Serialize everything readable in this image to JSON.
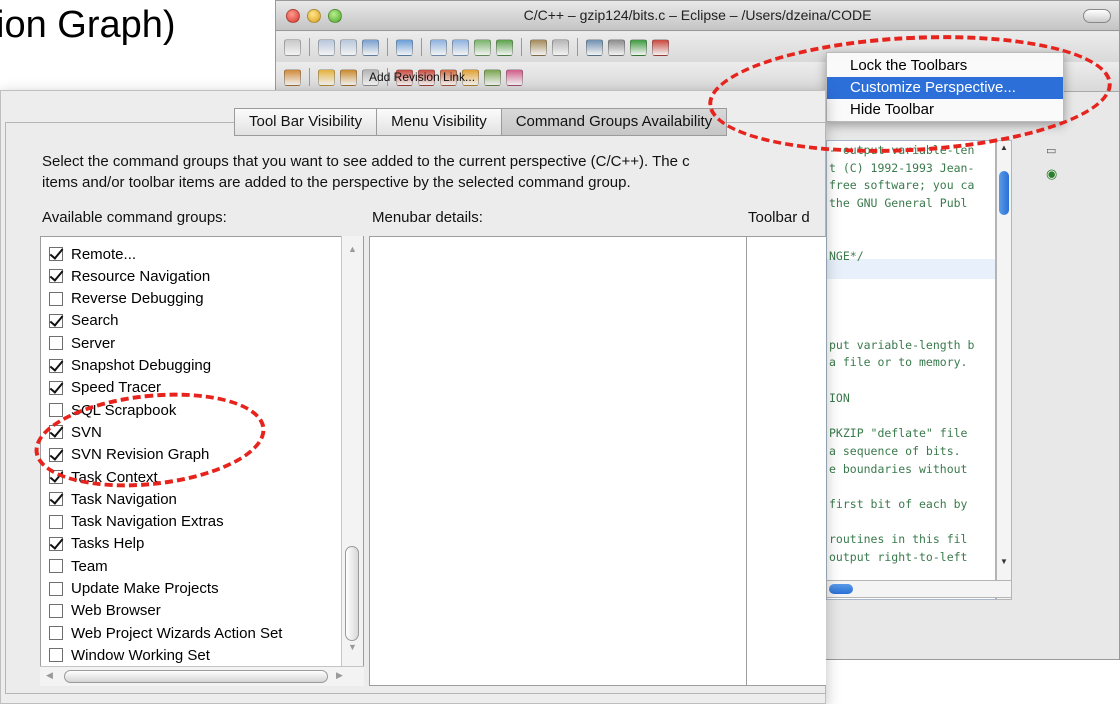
{
  "slide": {
    "title": "ion Graph)"
  },
  "window": {
    "title": "C/C++ – gzip124/bits.c – Eclipse – /Users/dzeina/CODE",
    "toolbar": {
      "add_revision_link": "Add Revision Link..."
    }
  },
  "context_menu": {
    "items": [
      {
        "label": "Lock the Toolbars",
        "selected": false
      },
      {
        "label": "Customize Perspective...",
        "selected": true
      },
      {
        "label": "Hide Toolbar",
        "selected": false
      }
    ]
  },
  "dialog": {
    "tabs": [
      {
        "label": "Tool Bar Visibility",
        "active": false
      },
      {
        "label": "Menu Visibility",
        "active": false
      },
      {
        "label": "Command Groups Availability",
        "active": true
      }
    ],
    "description": [
      "Select the command groups that you want to see added to the current perspective (C/C++).  The c",
      "items and/or toolbar items are added to the perspective by the selected command group."
    ],
    "available_label": "Available command groups:",
    "menubar_label": "Menubar details:",
    "toolbar_label": "Toolbar d",
    "command_groups": [
      {
        "label": "Remote...",
        "checked": true
      },
      {
        "label": "Resource Navigation",
        "checked": true
      },
      {
        "label": "Reverse Debugging",
        "checked": false
      },
      {
        "label": "Search",
        "checked": true
      },
      {
        "label": "Server",
        "checked": false
      },
      {
        "label": "Snapshot Debugging",
        "checked": true
      },
      {
        "label": "Speed Tracer",
        "checked": true
      },
      {
        "label": "SQL Scrapbook",
        "checked": false
      },
      {
        "label": "SVN",
        "checked": true
      },
      {
        "label": "SVN Revision Graph",
        "checked": true
      },
      {
        "label": "Task Context",
        "checked": true
      },
      {
        "label": "Task Navigation",
        "checked": true
      },
      {
        "label": "Task Navigation Extras",
        "checked": false
      },
      {
        "label": "Tasks Help",
        "checked": true
      },
      {
        "label": "Team",
        "checked": false
      },
      {
        "label": "Update Make Projects",
        "checked": false
      },
      {
        "label": "Web Browser",
        "checked": false
      },
      {
        "label": "Web Project Wizards Action Set",
        "checked": false
      },
      {
        "label": "Window Working Set",
        "checked": false
      }
    ]
  },
  "editor": {
    "lines": [
      "- output variable-len",
      "t (C) 1992-1993 Jean-",
      "free software; you ca",
      " the GNU General Publ",
      "",
      "",
      "NGE*/",
      "",
      "",
      "",
      "",
      "put variable-length b",
      "a file or to memory.",
      "",
      "ION",
      "",
      " PKZIP \"deflate\" file",
      "a sequence of bits.",
      "e boundaries without",
      "",
      " first bit of each by",
      "",
      " routines in this fil",
      "output right-to-left"
    ],
    "highlighted_line": 6
  },
  "colors": {
    "annotation": "#e6231c",
    "selection": "#2d6fd9"
  }
}
